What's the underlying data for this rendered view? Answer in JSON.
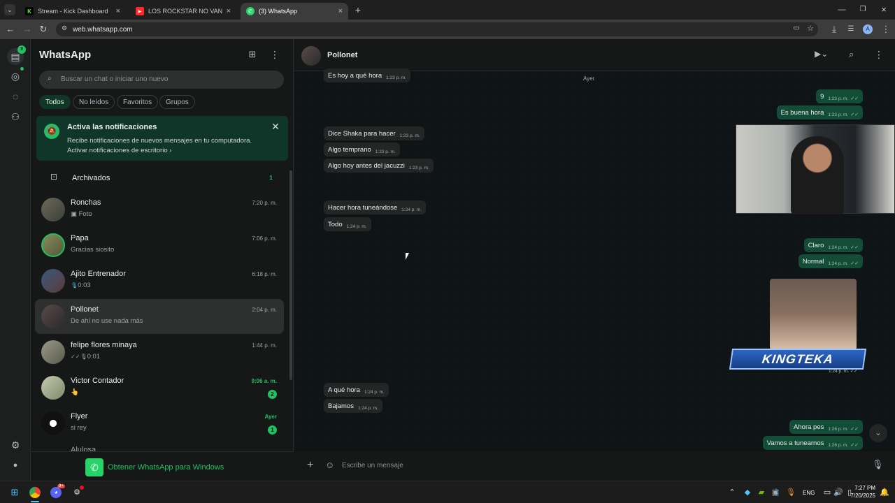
{
  "browser": {
    "tabs": [
      {
        "title": "Stream - Kick Dashboard",
        "favicon": "K",
        "color": "#53fc18"
      },
      {
        "title": "LOS ROCKSTAR NO VAN AL CIE",
        "favicon": "▶",
        "color": "#ff2a2a"
      },
      {
        "title": "(3) WhatsApp",
        "favicon": "✆",
        "color": "#25d366"
      }
    ],
    "url": "web.whatsapp.com",
    "profile_initial": "A"
  },
  "rail": {
    "chats_badge": "3"
  },
  "sidebar": {
    "title": "WhatsApp",
    "search_placeholder": "Buscar un chat o iniciar uno nuevo",
    "filters": [
      "Todos",
      "No leídos",
      "Favoritos",
      "Grupos"
    ],
    "notification": {
      "title": "Activa las notificaciones",
      "body": "Recibe notificaciones de nuevos mensajes en tu computadora.",
      "link": "Activar notificaciones de escritorio ›"
    },
    "archived": {
      "label": "Archivados",
      "count": "1"
    },
    "chats": [
      {
        "name": "Ronchas",
        "preview": "Foto",
        "preview_icon": "▣",
        "time": "7:20 p. m.",
        "unread": ""
      },
      {
        "name": "Papa",
        "preview": "Gracias siosito",
        "preview_icon": "",
        "time": "7:06 p. m.",
        "unread": ""
      },
      {
        "name": "Ajito Entrenador",
        "preview": "0:03",
        "preview_icon": "🎙",
        "time": "6:18 p. m.",
        "unread": ""
      },
      {
        "name": "Pollonet",
        "preview": "De ahí no use nada más",
        "preview_icon": "",
        "time": "2:04 p. m.",
        "unread": ""
      },
      {
        "name": "felipe flores minaya",
        "preview": "0:01",
        "preview_icon": "✓✓🎙",
        "time": "1:44 p. m.",
        "unread": ""
      },
      {
        "name": "Victor Contador",
        "preview": "👆",
        "preview_icon": "",
        "time": "9:06 a. m.",
        "unread": "2"
      },
      {
        "name": "Flyer",
        "preview": "si rey",
        "preview_icon": "",
        "time": "Ayer",
        "unread": "1"
      },
      {
        "name": "Alulosa",
        "preview": "",
        "preview_icon": "",
        "time": "",
        "unread": ""
      }
    ],
    "get_app": "Obtener WhatsApp para Windows"
  },
  "chat": {
    "contact": "Pollonet",
    "day_label": "Ayer",
    "input_placeholder": "Escribe un mensaje",
    "messages": [
      {
        "dir": "in",
        "text": "Es hoy a qué hora",
        "time": "1:23 p. m."
      },
      {
        "dir": "out",
        "text": "9",
        "time": "1:23 p. m."
      },
      {
        "dir": "out",
        "text": "Es buena hora",
        "time": "1:23 p. m."
      },
      {
        "dir": "in",
        "text": "Dice Shaka para hacer",
        "time": "1:23 p. m."
      },
      {
        "dir": "in",
        "text": "Algo temprano",
        "time": "1:23 p. m."
      },
      {
        "dir": "in",
        "text": "Algo hoy antes del jacuzzi",
        "time": "1:23 p. m."
      },
      {
        "dir": "in",
        "text": "Hacer hora tuneándose",
        "time": "1:24 p. m."
      },
      {
        "dir": "in",
        "text": "Todo",
        "time": "1:24 p. m."
      },
      {
        "dir": "out",
        "text": "Claro",
        "time": "1:24 p. m."
      },
      {
        "dir": "out",
        "text": "Normal",
        "time": "1:24 p. m."
      },
      {
        "dir": "out",
        "text": "",
        "time": "1:24 p. m."
      },
      {
        "dir": "in",
        "text": "A qué hora",
        "time": "1:24 p. m."
      },
      {
        "dir": "in",
        "text": "Bajamos",
        "time": "1:24 p. m."
      },
      {
        "dir": "out",
        "text": "Ahora pes",
        "time": "1:26 p. m."
      },
      {
        "dir": "out",
        "text": "Vamos a tunearnos",
        "time": "1:26 p. m."
      }
    ]
  },
  "overlay": {
    "banner": "KINGTEKA"
  },
  "taskbar": {
    "lang": "ENG",
    "time": "7:27 PM",
    "date": "7/20/2025",
    "discord_badge": "9+"
  }
}
